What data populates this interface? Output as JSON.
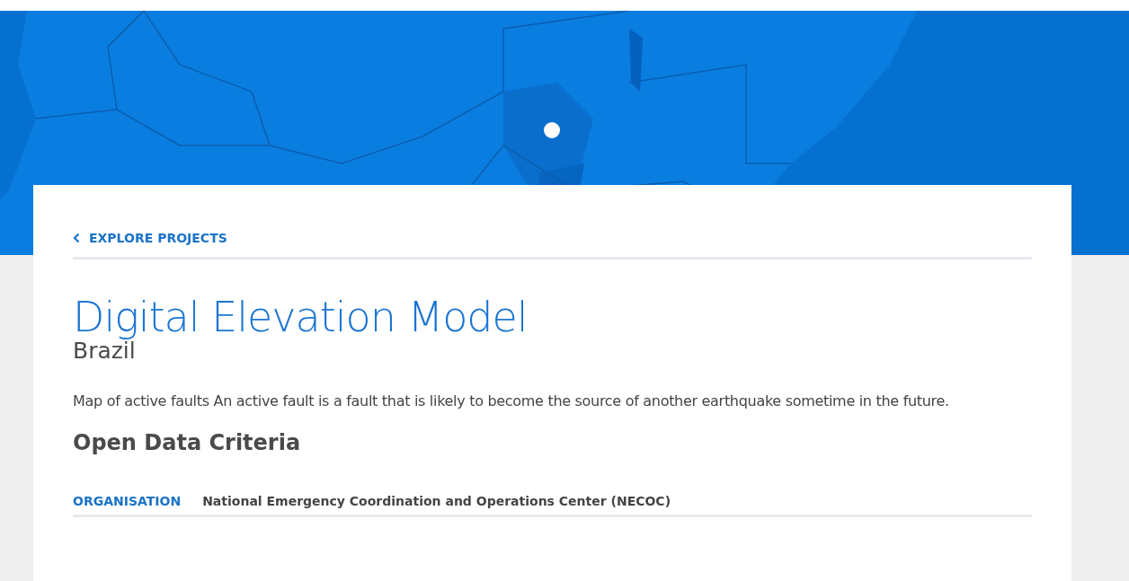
{
  "back_link": {
    "label": "EXPLORE PROJECTS"
  },
  "project": {
    "title": "Digital Elevation Model",
    "country": "Brazil",
    "description": "Map of active faults An active fault is a fault that is likely to become the source of another earthquake sometime in the future."
  },
  "section_title": "Open Data Criteria",
  "details": [
    {
      "label": "ORGANISATION",
      "value": "National Emergency Coordination and Operations Center (NECOC)"
    }
  ]
}
